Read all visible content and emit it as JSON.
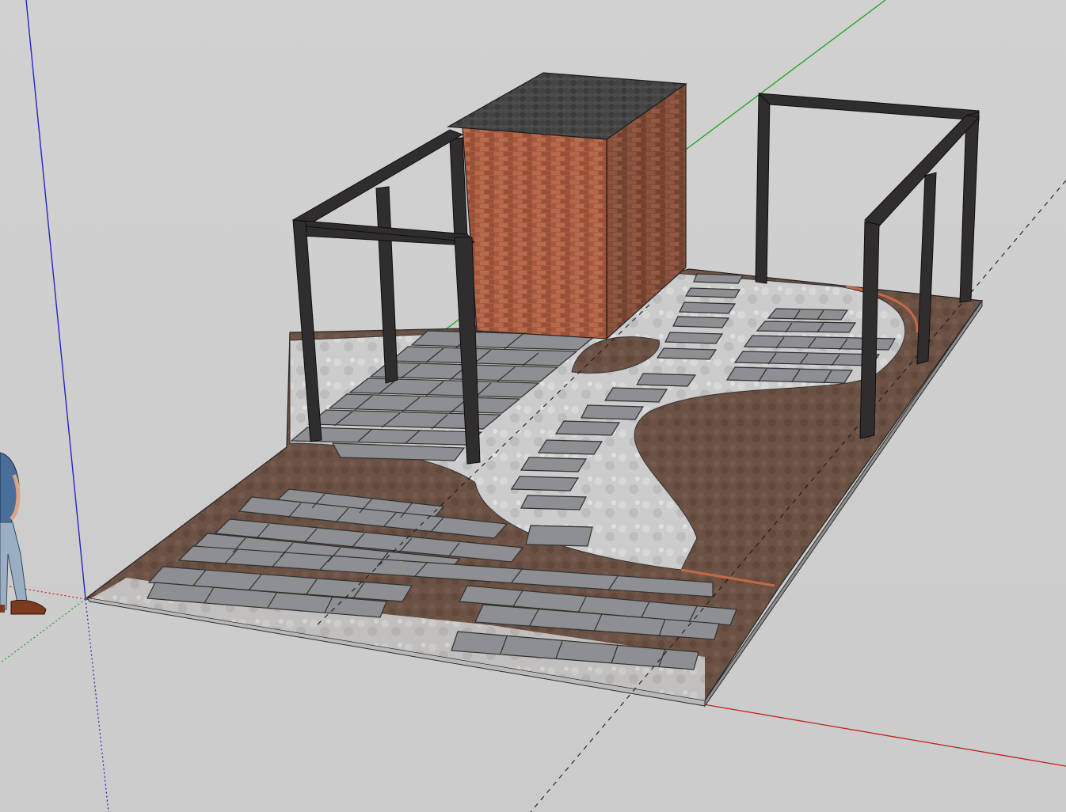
{
  "app": {
    "kind": "3D modeling viewport"
  },
  "colors": {
    "background": "#cfcfcf",
    "axis_red": "#c0201e",
    "axis_green": "#1aa51a",
    "axis_blue": "#2424c8",
    "soil": "#6b5244",
    "concrete": "#cdcdcd",
    "paver": "#8c8d91",
    "paver_edge": "#3a3a3c",
    "brick": "#a3583c",
    "roof": "#4a4a4a",
    "steel": "#2e2c2c"
  },
  "scene": {
    "objects": [
      "patio-slab",
      "brick-shed",
      "pergola-left",
      "pergola-right",
      "paving-area-front",
      "paving-area-back",
      "stepping-stone-path",
      "soil-bed",
      "scale-figure"
    ]
  }
}
